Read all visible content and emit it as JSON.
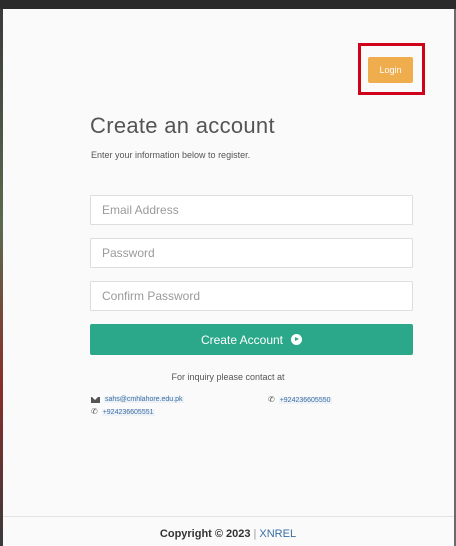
{
  "header": {
    "login_label": "Login"
  },
  "form": {
    "title": "Create an account",
    "subtitle": "Enter your information below to register.",
    "email_placeholder": "Email Address",
    "password_placeholder": "Password",
    "confirm_placeholder": "Confirm Password",
    "submit_label": "Create Account"
  },
  "contact": {
    "inquiry": "For inquiry please contact at",
    "email": "sahs@cmhlahore.edu.pk",
    "phone_1": "+924236605550",
    "phone_2": "+924236605551"
  },
  "footer": {
    "copyright": "Copyright © 2023",
    "separator": "|",
    "brand": "XNREL"
  },
  "colors": {
    "login_button": "#f0ad4e",
    "highlight": "#d0021b",
    "submit_button": "#2aa889"
  }
}
